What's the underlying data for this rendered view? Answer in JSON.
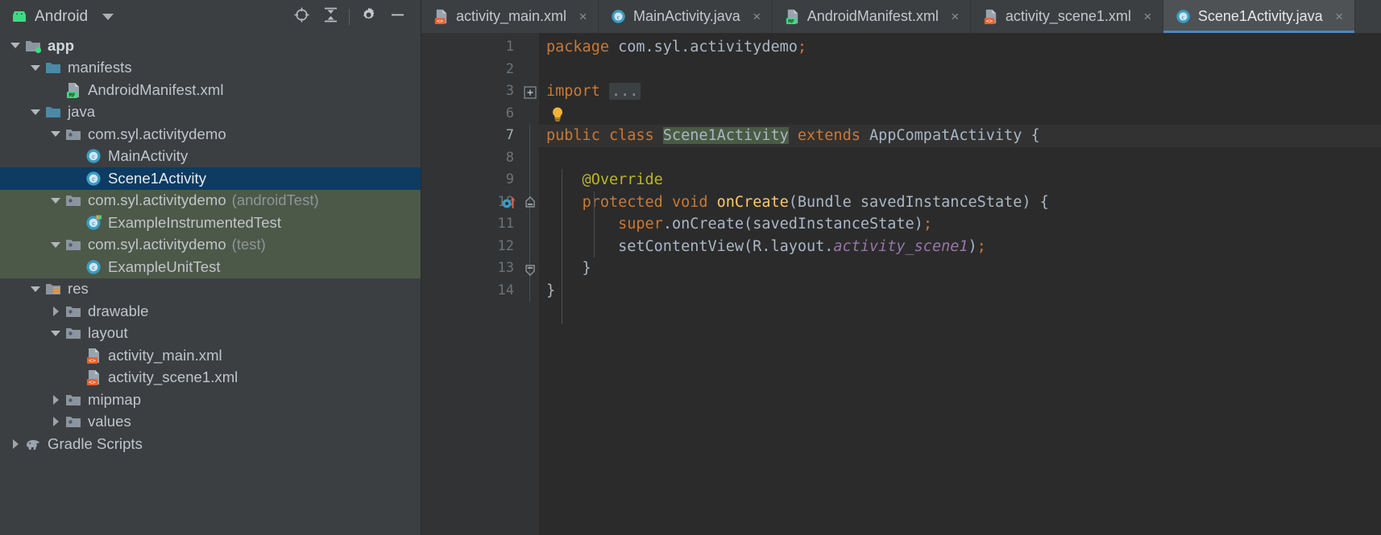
{
  "project_panel": {
    "title": "Android",
    "title_icon": "android-robot-icon",
    "dropdown_icon": "chevron-down-icon",
    "toolbar": [
      {
        "name": "select-opened-file-icon",
        "tooltip": "Select Opened File"
      },
      {
        "name": "collapse-all-icon",
        "tooltip": "Collapse All"
      },
      {
        "name": "gear-icon",
        "tooltip": "Settings"
      },
      {
        "name": "minimize-icon",
        "tooltip": "Hide"
      }
    ],
    "tree": [
      {
        "label": "app",
        "indent": 0,
        "twisty": "down",
        "icon": "module-folder-icon",
        "bold": true,
        "selected": false,
        "testsrc": false,
        "suffix": ""
      },
      {
        "label": "manifests",
        "indent": 1,
        "twisty": "down",
        "icon": "folder-icon",
        "bold": false,
        "selected": false,
        "testsrc": false,
        "suffix": ""
      },
      {
        "label": "AndroidManifest.xml",
        "indent": 2,
        "twisty": "none",
        "icon": "manifest-file-icon",
        "bold": false,
        "selected": false,
        "testsrc": false,
        "suffix": ""
      },
      {
        "label": "java",
        "indent": 1,
        "twisty": "down",
        "icon": "folder-icon",
        "bold": false,
        "selected": false,
        "testsrc": false,
        "suffix": ""
      },
      {
        "label": "com.syl.activitydemo",
        "indent": 2,
        "twisty": "down",
        "icon": "package-icon",
        "bold": false,
        "selected": false,
        "testsrc": false,
        "suffix": ""
      },
      {
        "label": "MainActivity",
        "indent": 3,
        "twisty": "none",
        "icon": "java-class-icon",
        "bold": false,
        "selected": false,
        "testsrc": false,
        "suffix": ""
      },
      {
        "label": "Scene1Activity",
        "indent": 3,
        "twisty": "none",
        "icon": "java-class-icon",
        "bold": false,
        "selected": true,
        "testsrc": false,
        "suffix": ""
      },
      {
        "label": "com.syl.activitydemo",
        "indent": 2,
        "twisty": "down",
        "icon": "package-icon",
        "bold": false,
        "selected": false,
        "testsrc": true,
        "suffix": "(androidTest)"
      },
      {
        "label": "ExampleInstrumentedTest",
        "indent": 3,
        "twisty": "none",
        "icon": "java-test-class-icon",
        "bold": false,
        "selected": false,
        "testsrc": true,
        "suffix": ""
      },
      {
        "label": "com.syl.activitydemo",
        "indent": 2,
        "twisty": "down",
        "icon": "package-icon",
        "bold": false,
        "selected": false,
        "testsrc": true,
        "suffix": "(test)"
      },
      {
        "label": "ExampleUnitTest",
        "indent": 3,
        "twisty": "none",
        "icon": "java-class-icon",
        "bold": false,
        "selected": false,
        "testsrc": true,
        "suffix": ""
      },
      {
        "label": "res",
        "indent": 1,
        "twisty": "down",
        "icon": "res-folder-icon",
        "bold": false,
        "selected": false,
        "testsrc": false,
        "suffix": ""
      },
      {
        "label": "drawable",
        "indent": 2,
        "twisty": "right",
        "icon": "package-icon",
        "bold": false,
        "selected": false,
        "testsrc": false,
        "suffix": ""
      },
      {
        "label": "layout",
        "indent": 2,
        "twisty": "down",
        "icon": "package-icon",
        "bold": false,
        "selected": false,
        "testsrc": false,
        "suffix": ""
      },
      {
        "label": "activity_main.xml",
        "indent": 3,
        "twisty": "none",
        "icon": "layout-xml-icon",
        "bold": false,
        "selected": false,
        "testsrc": false,
        "suffix": ""
      },
      {
        "label": "activity_scene1.xml",
        "indent": 3,
        "twisty": "none",
        "icon": "layout-xml-icon",
        "bold": false,
        "selected": false,
        "testsrc": false,
        "suffix": ""
      },
      {
        "label": "mipmap",
        "indent": 2,
        "twisty": "right",
        "icon": "package-icon",
        "bold": false,
        "selected": false,
        "testsrc": false,
        "suffix": ""
      },
      {
        "label": "values",
        "indent": 2,
        "twisty": "right",
        "icon": "package-icon",
        "bold": false,
        "selected": false,
        "testsrc": false,
        "suffix": ""
      },
      {
        "label": "Gradle Scripts",
        "indent": 0,
        "twisty": "right",
        "icon": "gradle-elephant-icon",
        "bold": false,
        "selected": false,
        "testsrc": false,
        "suffix": ""
      }
    ]
  },
  "editor": {
    "tabs": [
      {
        "label": "activity_main.xml",
        "icon": "layout-xml-icon",
        "active": false,
        "close": "×"
      },
      {
        "label": "MainActivity.java",
        "icon": "java-class-icon",
        "active": false,
        "close": "×"
      },
      {
        "label": "AndroidManifest.xml",
        "icon": "manifest-file-icon",
        "active": false,
        "close": "×"
      },
      {
        "label": "activity_scene1.xml",
        "icon": "layout-xml-icon",
        "active": false,
        "close": "×"
      },
      {
        "label": "Scene1Activity.java",
        "icon": "java-class-icon",
        "active": true,
        "close": "×"
      }
    ],
    "line_numbers": [
      "1",
      "2",
      "3",
      "6",
      "7",
      "8",
      "9",
      "10",
      "11",
      "12",
      "13",
      "14"
    ],
    "current_line_index": 4,
    "gutter_markers": [
      {
        "row": 7,
        "name": "override-method-marker-icon"
      }
    ],
    "fold_markers": [
      {
        "row": 2,
        "name": "expand-fold-icon"
      },
      {
        "row": 7,
        "name": "collapse-fold-top-icon"
      },
      {
        "row": 10,
        "name": "collapse-fold-bottom-icon"
      }
    ],
    "intention_bulb": {
      "row": 3,
      "name": "intention-bulb-icon"
    },
    "code_lines": [
      {
        "n": "1",
        "segments": [
          {
            "t": "package ",
            "c": "kw"
          },
          {
            "t": "com.syl.activitydemo",
            "c": "punct"
          },
          {
            "t": ";",
            "c": "semi"
          }
        ]
      },
      {
        "n": "2",
        "segments": []
      },
      {
        "n": "3",
        "segments": [
          {
            "t": "import ",
            "c": "kw"
          },
          {
            "t": "...",
            "c": "fold"
          }
        ]
      },
      {
        "n": "6",
        "segments": []
      },
      {
        "n": "7",
        "segments": [
          {
            "t": "public ",
            "c": "kw"
          },
          {
            "t": "class ",
            "c": "kw"
          },
          {
            "t": "Scene1Activity",
            "c": "hl"
          },
          {
            "t": " ",
            "c": "punct"
          },
          {
            "t": "extends ",
            "c": "kw"
          },
          {
            "t": "AppCompatActivity ",
            "c": "punct"
          },
          {
            "t": "{",
            "c": "punct"
          }
        ]
      },
      {
        "n": "8",
        "segments": []
      },
      {
        "n": "9",
        "segments": [
          {
            "t": "    @Override",
            "c": "anno"
          }
        ]
      },
      {
        "n": "10",
        "segments": [
          {
            "t": "    ",
            "c": "punct"
          },
          {
            "t": "protected ",
            "c": "kw"
          },
          {
            "t": "void ",
            "c": "kw"
          },
          {
            "t": "onCreate",
            "c": "fn"
          },
          {
            "t": "(Bundle savedInstanceState) {",
            "c": "punct"
          }
        ]
      },
      {
        "n": "11",
        "segments": [
          {
            "t": "        ",
            "c": "punct"
          },
          {
            "t": "super",
            "c": "kw"
          },
          {
            "t": ".onCreate(savedInstanceState)",
            "c": "punct"
          },
          {
            "t": ";",
            "c": "semi"
          }
        ]
      },
      {
        "n": "12",
        "segments": [
          {
            "t": "        setContentView(R.layout.",
            "c": "punct"
          },
          {
            "t": "activity_scene1",
            "c": "fld"
          },
          {
            "t": ")",
            "c": "punct"
          },
          {
            "t": ";",
            "c": "semi"
          }
        ]
      },
      {
        "n": "13",
        "segments": [
          {
            "t": "    }",
            "c": "punct"
          }
        ]
      },
      {
        "n": "14",
        "segments": [
          {
            "t": "}",
            "c": "punct"
          }
        ]
      }
    ]
  },
  "colors": {
    "panel_bg": "#3c3f41",
    "editor_bg": "#2b2b2b",
    "gutter_bg": "#313335",
    "selection_blue": "#0d3b61",
    "test_source_green": "#4c5948",
    "active_tab_bg": "#4e5254",
    "tab_underline": "#4a88c7",
    "keyword_orange": "#cc7832",
    "string_green": "#6a8759",
    "method_yellow": "#ffc66d",
    "annotation_olive": "#bbb529",
    "field_purple": "#9876aa",
    "text_gray": "#a9b7c6"
  }
}
